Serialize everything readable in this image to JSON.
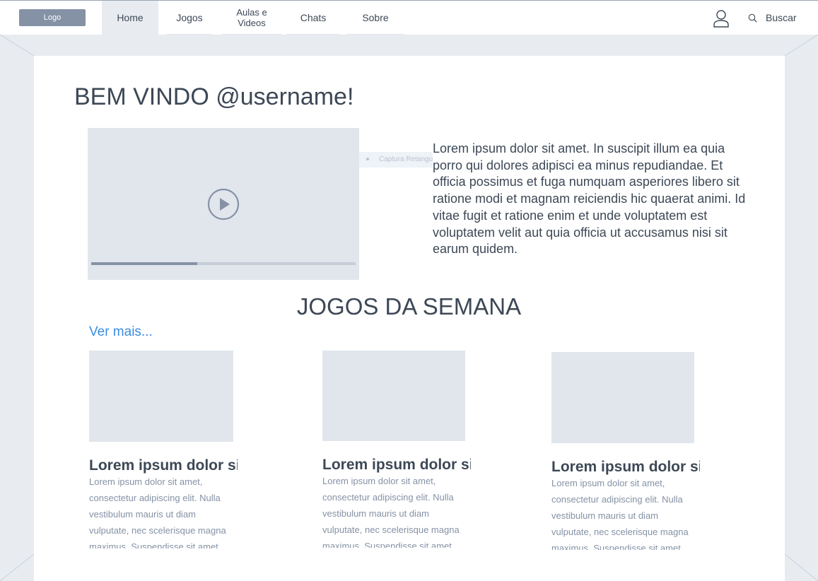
{
  "nav": {
    "logo": "Logo",
    "items": [
      {
        "label": "Home",
        "active": true
      },
      {
        "label": "Jogos"
      },
      {
        "label": "Aulas e\nVideos"
      },
      {
        "label": "Chats"
      },
      {
        "label": "Sobre"
      }
    ],
    "search_label": "Buscar",
    "user_icon": "user-icon",
    "search_icon": "search-icon"
  },
  "welcome": "BEM VINDO @username!",
  "video": {
    "play_icon": "play-icon",
    "progress": 0.4
  },
  "capture_tooltip": "Captura Retangular",
  "intro": "Lorem ipsum dolor sit amet. In suscipit illum ea quia porro qui dolores adipisci ea minus repudiandae. Et officia possimus et fuga numquam asperiores libero sit ratione modi et magnam reiciendis hic quaerat animi. Id vitae fugit et ratione enim et unde voluptatem est voluptatem velit aut quia officia ut accusamus nisi sit earum quidem.",
  "section": {
    "title": "JOGOS DA SEMANA",
    "see_more": "Ver mais..."
  },
  "cards": [
    {
      "title": "Lorem ipsum dolor sit amet",
      "body": "Lorem ipsum dolor sit amet, consectetur adipiscing elit. Nulla vestibulum mauris ut diam vulputate, nec scelerisque magna maximus. Suspendisse sit amet."
    },
    {
      "title": "Lorem ipsum dolor sit amet",
      "body": "Lorem ipsum dolor sit amet, consectetur adipiscing elit. Nulla vestibulum mauris ut diam vulputate, nec scelerisque magna maximus. Suspendisse sit amet."
    },
    {
      "title": "Lorem ipsum dolor sit amet",
      "body": "Lorem ipsum dolor sit amet, consectetur adipiscing elit. Nulla vestibulum mauris ut diam vulputate, nec scelerisque magna maximus. Suspendisse sit amet."
    }
  ],
  "colors": {
    "accent": "#3b8de0",
    "text": "#3d4856",
    "muted": "#8592a5",
    "placeholder": "#e1e6ed",
    "frame": "#e8ecf1"
  }
}
